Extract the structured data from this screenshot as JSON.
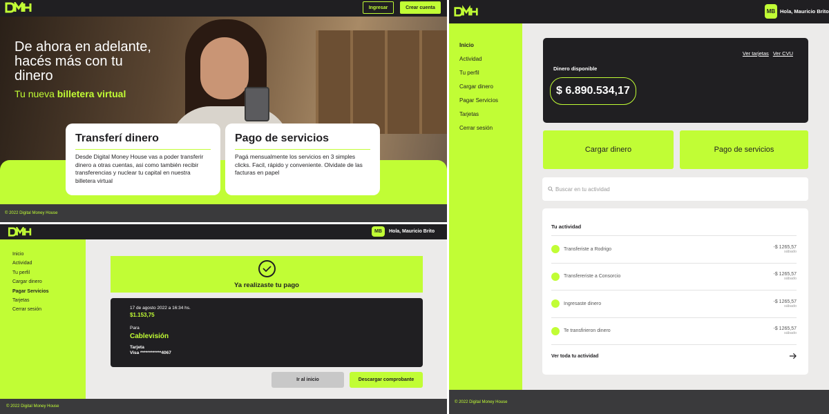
{
  "brand": {
    "logo_text": "DMH",
    "accent": "#c1fd35",
    "dark": "#201f22"
  },
  "landing": {
    "login_label": "Ingresar",
    "signup_label": "Crear cuenta",
    "hero_title": "De ahora en adelante, hacés más con tu dinero",
    "hero_sub_prefix": "Tu nueva ",
    "hero_sub_bold": "billetera virtual",
    "cards": [
      {
        "title": "Transferí dinero",
        "text": "Desde Digital Money House vas a poder transferir dinero a otras cuentas, asi como también recibir transferencias y nuclear tu capital en nuestra billetera virtual"
      },
      {
        "title": "Pago de servicios",
        "text": "Pagá mensualmente los servicios en 3 simples clicks. Facil, rápido y conveniente. Olvidate de las facturas en papel"
      }
    ],
    "footer": "© 2022 Digital Money House"
  },
  "user": {
    "initials": "MB",
    "greeting": "Hola, Mauricio Brito"
  },
  "nav": [
    "Inicio",
    "Actividad",
    "Tu perfil",
    "Cargar dinero",
    "Pagar Servicios",
    "Tarjetas",
    "Cerrar sesión"
  ],
  "payment": {
    "success_text": "Ya realizaste tu pago",
    "date": "17 de agosto 2022 a 16:34 hs.",
    "amount": "$1.153,75",
    "para_label": "Para",
    "recipient": "Cablevisión",
    "card_label": "Tarjeta",
    "card_value": "Visa ************4067",
    "home_button": "Ir al inicio",
    "download_button": "Descargar comprobante",
    "footer": "© 2022 Digital Money House"
  },
  "dashboard": {
    "view_cards": "Ver tarjetas",
    "view_cvu": "Ver CVU",
    "balance_label": "Dinero disponible",
    "balance": "$ 6.890.534,17",
    "load_money": "Cargar dinero",
    "pay_services": "Pago de servicios",
    "search_placeholder": "Buscar en tu actividad",
    "activity_title": "Tu actividad",
    "activity": [
      {
        "text": "Transferiste a Rodrigo",
        "amount": "-$ 1265,57",
        "day": "sábado"
      },
      {
        "text": "Transfereriste a Consorcio",
        "amount": "-$ 1265,57",
        "day": "sábado"
      },
      {
        "text": "Ingresaste dinero",
        "amount": "-$ 1265,57",
        "day": "sábado"
      },
      {
        "text": "Te transfirieron dinero",
        "amount": "-$ 1265,57",
        "day": "sábado"
      }
    ],
    "see_all": "Ver toda tu actividad",
    "footer": "© 2022 Digital Money House"
  },
  "icons": {
    "check": "check-circle-icon",
    "search": "search-icon",
    "arrow": "arrow-right-icon"
  }
}
